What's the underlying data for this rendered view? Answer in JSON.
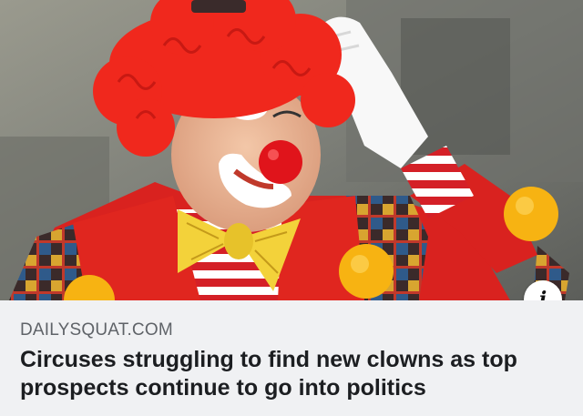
{
  "link_preview": {
    "domain": "DAILYSQUAT.COM",
    "headline": "Circuses struggling to find new clowns as top prospects continue to go into politics",
    "image_subject": "clown with red curly hair, red nose, white glove, yellow bow tie and red jacket with yellow pom-poms",
    "info_icon": "info-icon"
  },
  "colors": {
    "panel_background": "#f0f1f3",
    "domain_text": "#5f6368",
    "headline_text": "#1c1e21"
  }
}
